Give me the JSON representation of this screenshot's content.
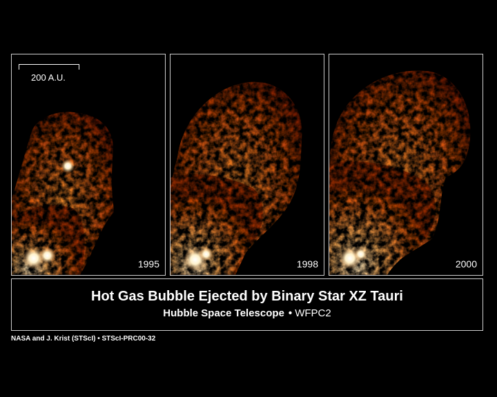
{
  "scale_bar": {
    "label": "200 A.U."
  },
  "panels": [
    {
      "year": "1995"
    },
    {
      "year": "1998"
    },
    {
      "year": "2000"
    }
  ],
  "caption": {
    "title": "Hot Gas Bubble Ejected by Binary Star XZ Tauri",
    "subtitle_main": "Hubble Space Telescope",
    "subtitle_bullet": "•",
    "subtitle_instrument": "WFPC2"
  },
  "credit": "NASA and J. Krist (STScI) • STScI-PRC00-32",
  "colors": {
    "nebula_dark": "#8a1e00",
    "nebula_mid": "#e0580c",
    "nebula_bright": "#ffc27a",
    "star_core": "#fffbe6"
  }
}
